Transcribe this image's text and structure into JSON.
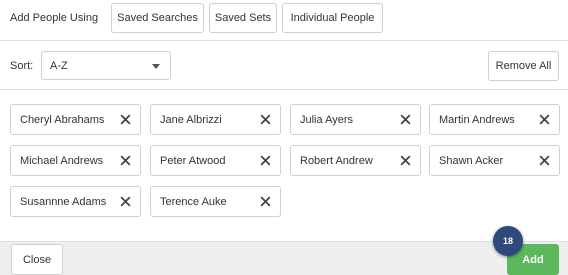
{
  "header": {
    "add_people_label": "Add People Using",
    "tabs": [
      {
        "label": "Saved Searches"
      },
      {
        "label": "Saved Sets"
      },
      {
        "label": "Individual People"
      }
    ]
  },
  "sort": {
    "label": "Sort:",
    "selected": "A-Z"
  },
  "remove_all_label": "Remove All",
  "people": [
    {
      "name": "Cheryl Abrahams"
    },
    {
      "name": "Jane Albrizzi"
    },
    {
      "name": "Julia Ayers"
    },
    {
      "name": "Martin Andrews"
    },
    {
      "name": "Michael Andrews"
    },
    {
      "name": "Peter Atwood"
    },
    {
      "name": "Robert Andrew"
    },
    {
      "name": "Shawn Acker"
    },
    {
      "name": "Susannne Adams"
    },
    {
      "name": "Terence Auke"
    }
  ],
  "footer": {
    "close_label": "Close",
    "add_label": "Add",
    "count_badge": "18"
  },
  "colors": {
    "add_button": "#5cb85c",
    "badge": "#2e4a7d"
  }
}
